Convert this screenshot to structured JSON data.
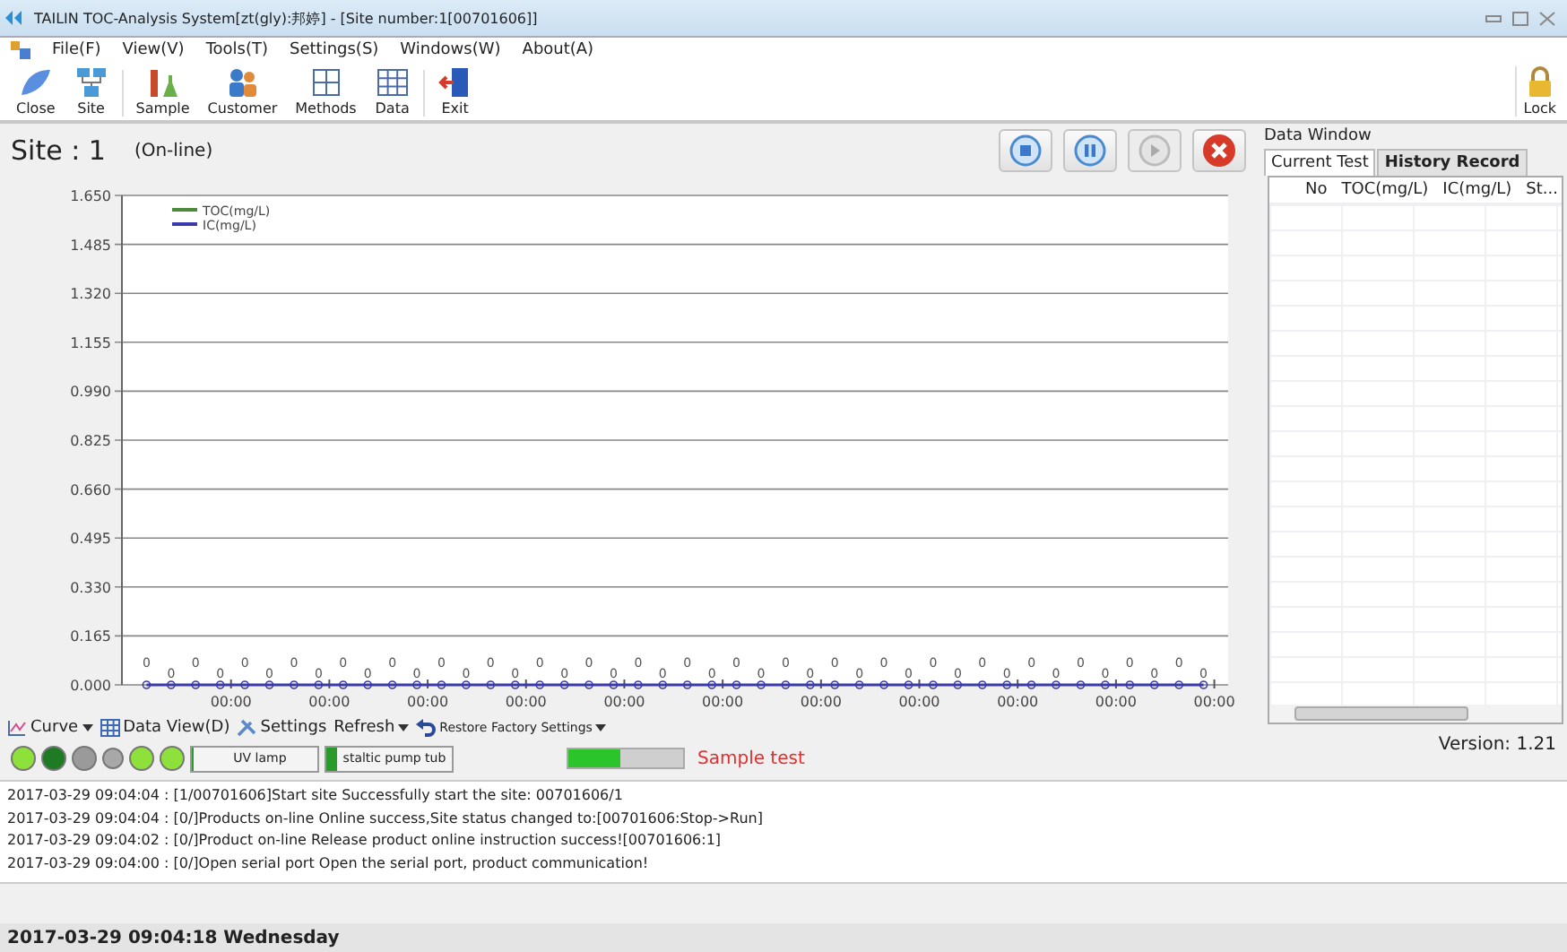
{
  "window": {
    "title": "TAILIN TOC-Analysis System[zt(gly):邦婷] - [Site number:1[00701606]]"
  },
  "menu": [
    "File(F)",
    "View(V)",
    "Tools(T)",
    "Settings(S)",
    "Windows(W)",
    "About(A)"
  ],
  "toolbar": [
    {
      "label": "Close",
      "kind": "close"
    },
    {
      "label": "Site",
      "kind": "site"
    },
    {
      "label": "Sample",
      "kind": "sample"
    },
    {
      "label": "Customer",
      "kind": "customer"
    },
    {
      "label": "Methods",
      "kind": "methods"
    },
    {
      "label": "Data",
      "kind": "data"
    },
    {
      "label": "Exit",
      "kind": "exit"
    }
  ],
  "lock": {
    "label": "Lock"
  },
  "site": {
    "label": "Site : ",
    "number": "1",
    "status": "(On-line)"
  },
  "controls": [
    {
      "kind": "stop",
      "disabled": false
    },
    {
      "kind": "pause",
      "disabled": false
    },
    {
      "kind": "play",
      "disabled": true
    },
    {
      "kind": "cancel",
      "disabled": false
    }
  ],
  "chart": {
    "legend": [
      {
        "name": "TOC(mg/L)",
        "color": "#4a8a3a"
      },
      {
        "name": "IC(mg/L)",
        "color": "#3a3aa8"
      }
    ],
    "y_labels": [
      "1.650",
      "1.485",
      "1.320",
      "1.155",
      "0.990",
      "0.825",
      "0.660",
      "0.495",
      "0.330",
      "0.165",
      "0.000"
    ],
    "x_labels": [
      "00:00",
      "00:00",
      "00:00",
      "00:00",
      "00:00",
      "00:00",
      "00:00",
      "00:00",
      "00:00",
      "00:00",
      "00:00"
    ],
    "point_labels": [
      "0",
      "0",
      "0",
      "0",
      "0",
      "0",
      "0",
      "0",
      "0",
      "0",
      "0",
      "0",
      "0",
      "0",
      "0",
      "0",
      "0",
      "0",
      "0",
      "0",
      "0",
      "0",
      "0",
      "0",
      "0",
      "0",
      "0",
      "0",
      "0",
      "0",
      "0",
      "0",
      "0",
      "0",
      "0",
      "0",
      "0",
      "0",
      "0",
      "0",
      "0",
      "0",
      "0",
      "0"
    ]
  },
  "chart_toolbar": [
    {
      "label": "Curve",
      "kind": "curve",
      "dropdown": true
    },
    {
      "label": "Data View(D)",
      "kind": "grid",
      "dropdown": false
    },
    {
      "label": "Settings",
      "kind": "settings",
      "dropdown": false
    },
    {
      "label": "Refresh",
      "kind": "none",
      "dropdown": true
    },
    {
      "label": "Restore Factory Settings",
      "kind": "undo",
      "dropdown": true
    }
  ],
  "indicators": [
    {
      "color": "#8ee03a"
    },
    {
      "color": "#1f7a24"
    },
    {
      "color": "#9a9a9a"
    },
    {
      "color": "#a8a8a8"
    },
    {
      "color": "#8ee03a"
    },
    {
      "color": "#8ee03a"
    }
  ],
  "gauges": [
    {
      "label": "UV lamp",
      "level": 0.02
    },
    {
      "label": "staltic pump tub",
      "level": 0.08
    }
  ],
  "progress": {
    "level": 0.45,
    "label": "Sample test"
  },
  "data_window": {
    "title": "Data Window",
    "tabs": [
      {
        "label": "Current Test",
        "selected": true
      },
      {
        "label": "History Record",
        "selected": false
      }
    ],
    "columns": [
      "No",
      "TOC(mg/L)",
      "IC(mg/L)",
      "St..."
    ]
  },
  "version": "Version: 1.21",
  "log": [
    "2017-03-29 09:04:04 : [1/00701606]Start site  Successfully start the site: 00701606/1",
    "2017-03-29 09:04:04 : [0/]Products on-line  Online success,Site status changed to:[00701606:Stop->Run]",
    "2017-03-29 09:04:02 : [0/]Product on-line  Release product online instruction success![00701606:1]",
    "2017-03-29 09:04:00 : [0/]Open serial port  Open the serial port, product communication!"
  ],
  "status_bar": "2017-03-29 09:04:18 Wednesday"
}
